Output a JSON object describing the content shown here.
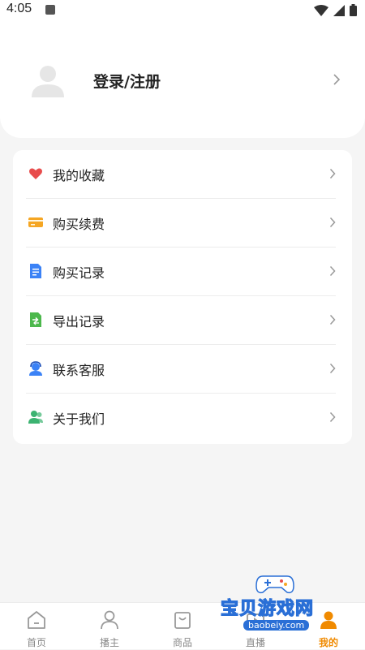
{
  "status_bar": {
    "time": "4:05"
  },
  "header": {
    "login_label": "登录/注册",
    "avatar_icon": "user-avatar-icon"
  },
  "menu": {
    "items": [
      {
        "label": "我的收藏",
        "icon": "heart-icon",
        "color": "#e84c4c"
      },
      {
        "label": "购买续费",
        "icon": "card-icon",
        "color": "#f5a623"
      },
      {
        "label": "购买记录",
        "icon": "document-icon",
        "color": "#3b82f6"
      },
      {
        "label": "导出记录",
        "icon": "export-icon",
        "color": "#4cb84c"
      },
      {
        "label": "联系客服",
        "icon": "customer-service-icon",
        "color": "#3b82f6"
      },
      {
        "label": "关于我们",
        "icon": "people-icon",
        "color": "#3cb371"
      }
    ]
  },
  "tab_bar": {
    "tabs": [
      {
        "label": "首页",
        "icon": "home-icon"
      },
      {
        "label": "播主",
        "icon": "person-icon"
      },
      {
        "label": "商品",
        "icon": "bag-icon"
      },
      {
        "label": "直播",
        "icon": "live-icon"
      },
      {
        "label": "我的",
        "icon": "me-icon"
      }
    ],
    "active_index": 4,
    "active_color": "#f08a00"
  },
  "watermark": {
    "text": "宝贝游戏网",
    "url": "baobeiy.com"
  }
}
